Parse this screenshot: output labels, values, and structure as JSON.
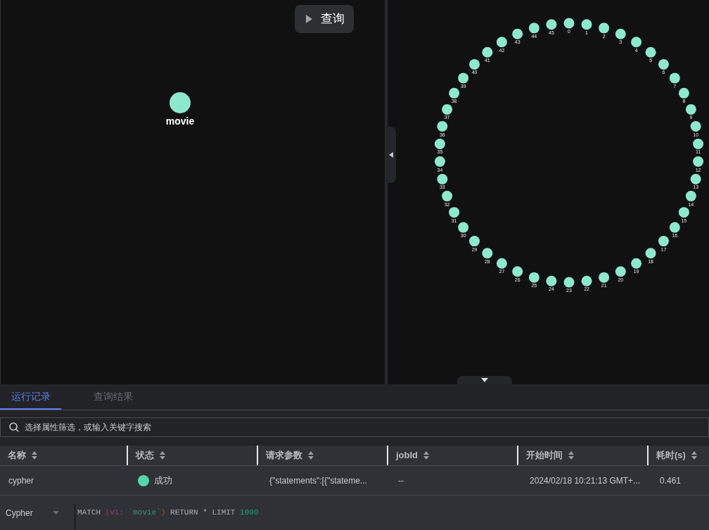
{
  "query_button": {
    "label": "查询"
  },
  "left_graph": {
    "nodes": [
      {
        "label": "movie"
      }
    ]
  },
  "right_graph": {
    "right_arc_nodes": [
      "0",
      "1",
      "2",
      "3",
      "4",
      "5",
      "6",
      "7",
      "8",
      "9",
      "10",
      "11",
      "12",
      "13",
      "14",
      "15",
      "16",
      "17",
      "18",
      "19",
      "20",
      "21",
      "22",
      "23"
    ],
    "left_arc_nodes": [
      "45",
      "44",
      "43",
      "42",
      "41",
      "40",
      "39",
      "38",
      "37",
      "36",
      "35",
      "34",
      "33",
      "32",
      "31",
      "30",
      "29",
      "28",
      "27",
      "26",
      "25",
      "24"
    ]
  },
  "tabs": [
    {
      "label": "运行记录",
      "selected": true
    },
    {
      "label": "查询结果",
      "selected": false
    }
  ],
  "search": {
    "placeholder": "选择属性筛选，或输入关键字搜索"
  },
  "table": {
    "columns": [
      "名称",
      "状态",
      "请求参数",
      "jobId",
      "开始时间",
      "耗时(s)"
    ],
    "rows": [
      {
        "name": "cypher",
        "status": {
          "text": "成功",
          "color": "#52d6ab"
        },
        "params": "{\"statements\":[{\"stateme...",
        "job_id": "--",
        "start_time": "2024/02/18 10:21:13 GMT+...",
        "duration": "0.461"
      }
    ]
  },
  "editor": {
    "language": "Cypher",
    "code": [
      {
        "text": "MATCH ",
        "kind": "keyword"
      },
      {
        "text": "(",
        "kind": "paren"
      },
      {
        "text": "v1: ",
        "kind": "variable"
      },
      {
        "text": "`movie`",
        "kind": "string"
      },
      {
        "text": ")",
        "kind": "paren"
      },
      {
        "text": " RETURN * LIMIT ",
        "kind": "keyword"
      },
      {
        "text": "1000",
        "kind": "number"
      }
    ]
  }
}
